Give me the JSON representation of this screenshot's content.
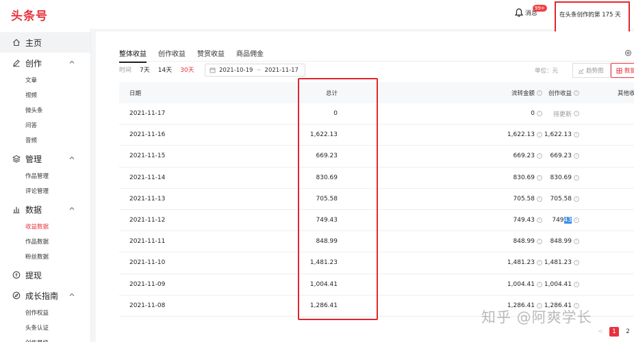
{
  "header": {
    "logo": "头条号",
    "messages_label": "消息",
    "messages_badge": "99+",
    "days_text": "在头条创作的第 175 天"
  },
  "sidebar": {
    "groups": [
      {
        "label": "主页",
        "icon": "home-icon",
        "items": []
      },
      {
        "label": "创作",
        "icon": "pen-icon",
        "items": [
          "文章",
          "视频",
          "微头条",
          "问答",
          "音频"
        ]
      },
      {
        "label": "管理",
        "icon": "layers-icon",
        "items": [
          "作品管理",
          "评论管理"
        ]
      },
      {
        "label": "数据",
        "icon": "bar-chart-icon",
        "items": [
          "收益数据",
          "作品数据",
          "粉丝数据"
        ],
        "active_item": "收益数据"
      },
      {
        "label": "提现",
        "icon": "coin-icon",
        "items": []
      },
      {
        "label": "成长指南",
        "icon": "compass-icon",
        "items": [
          "创作权益",
          "头条认证",
          "创作星级"
        ]
      }
    ]
  },
  "tabs": [
    "整体收益",
    "创作收益",
    "赞赏收益",
    "商品佣金"
  ],
  "active_tab": "整体收益",
  "filters": {
    "label": "时间",
    "options": [
      "7天",
      "14天",
      "30天"
    ],
    "active": "30天",
    "date_start": "2021-10-19",
    "date_sep": "~",
    "date_end": "2021-11-17"
  },
  "unit_label": "单位：元",
  "view_buttons": {
    "trend": "趋势图",
    "data": "数据"
  },
  "table": {
    "columns": [
      "日期",
      "总计",
      "流转金额",
      "创作收益",
      "其他收益"
    ],
    "rows": [
      {
        "date": "2021-11-17",
        "total": "0",
        "flow": "0",
        "create": "待更新",
        "pending": true
      },
      {
        "date": "2021-11-16",
        "total": "1,622.13",
        "flow": "1,622.13",
        "create": "1,622.13"
      },
      {
        "date": "2021-11-15",
        "total": "669.23",
        "flow": "669.23",
        "create": "669.23"
      },
      {
        "date": "2021-11-14",
        "total": "830.69",
        "flow": "830.69",
        "create": "830.69"
      },
      {
        "date": "2021-11-13",
        "total": "705.58",
        "flow": "705.58",
        "create": "705.58"
      },
      {
        "date": "2021-11-12",
        "total": "749.43",
        "flow": "749.43",
        "create": "749.43",
        "create_highlight": "43"
      },
      {
        "date": "2021-11-11",
        "total": "848.99",
        "flow": "848.99",
        "create": "848.99"
      },
      {
        "date": "2021-11-10",
        "total": "1,481.23",
        "flow": "1,481.23",
        "create": "1,481.23"
      },
      {
        "date": "2021-11-09",
        "total": "1,004.41",
        "flow": "1,004.41",
        "create": "1,004.41"
      },
      {
        "date": "2021-11-08",
        "total": "1,286.41",
        "flow": "1,286.41",
        "create": "1,286.41"
      }
    ]
  },
  "pagination": {
    "pages": [
      "1",
      "2"
    ],
    "active": "1",
    "prev": "<"
  },
  "watermark": "知乎 @阿爽学长",
  "colors": {
    "brand": "#e8313c",
    "highlight_box": "#e3242b",
    "selection": "#3d8ee8"
  }
}
